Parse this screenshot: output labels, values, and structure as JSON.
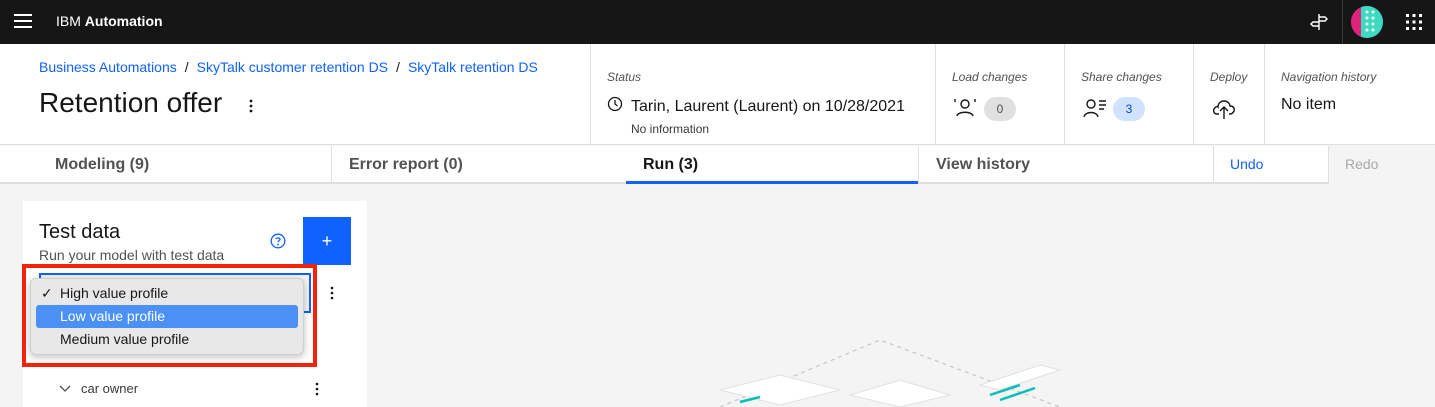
{
  "topbar": {
    "brand_prefix": "IBM",
    "brand_name": "Automation",
    "icons": [
      "menu-icon",
      "signpost-icon",
      "avatar",
      "app-switcher-icon"
    ]
  },
  "header": {
    "breadcrumb": [
      "Business Automations",
      "SkyTalk customer retention DS",
      "SkyTalk retention DS"
    ],
    "breadcrumb_sep": "/",
    "title": "Retention offer",
    "status": {
      "label": "Status",
      "text": "Tarin, Laurent (Laurent) on 10/28/2021",
      "sub": "No information"
    },
    "load_changes": {
      "label": "Load changes",
      "count": "0"
    },
    "share_changes": {
      "label": "Share changes",
      "count": "3"
    },
    "deploy": {
      "label": "Deploy"
    },
    "nav_history": {
      "label": "Navigation history",
      "value": "No item"
    }
  },
  "tabs": [
    {
      "label": "Modeling (9)"
    },
    {
      "label": "Error report (0)"
    },
    {
      "label": "Run (3)",
      "active": true
    },
    {
      "label": "View history"
    }
  ],
  "actions": {
    "undo": "Undo",
    "redo": "Redo"
  },
  "panel": {
    "title": "Test data",
    "subtitle": "Run your model with test data",
    "add_label": "+",
    "tree_item": "car owner"
  },
  "dropdown": {
    "options": [
      {
        "label": "High value profile",
        "checked": true,
        "check_mark": "✓"
      },
      {
        "label": "Low value profile",
        "highlighted": true
      },
      {
        "label": "Medium value profile"
      }
    ]
  },
  "colors": {
    "accent": "#0f62fe",
    "highlight_border": "#f5220a",
    "topbar": "#161616"
  }
}
